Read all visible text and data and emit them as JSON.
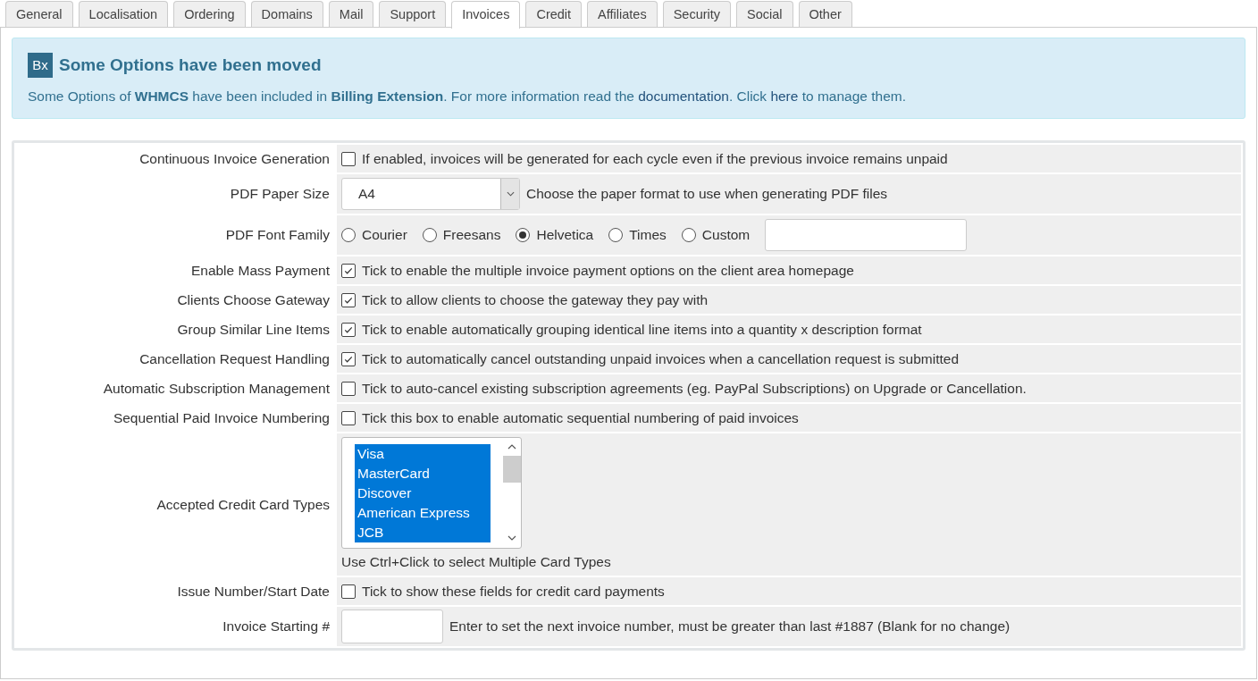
{
  "tabs": [
    {
      "label": "General",
      "selected": false
    },
    {
      "label": "Localisation",
      "selected": false
    },
    {
      "label": "Ordering",
      "selected": false
    },
    {
      "label": "Domains",
      "selected": false
    },
    {
      "label": "Mail",
      "selected": false
    },
    {
      "label": "Support",
      "selected": false
    },
    {
      "label": "Invoices",
      "selected": true
    },
    {
      "label": "Credit",
      "selected": false
    },
    {
      "label": "Affiliates",
      "selected": false
    },
    {
      "label": "Security",
      "selected": false
    },
    {
      "label": "Social",
      "selected": false
    },
    {
      "label": "Other",
      "selected": false
    }
  ],
  "alert": {
    "logo": "Bx",
    "title": "Some Options have been moved",
    "message": [
      {
        "kind": "text",
        "text": "Some Options of **WHMCS** have been included in **Billing Extension**. For more information read the "
      },
      {
        "kind": "link",
        "text": "documentation"
      },
      {
        "kind": "text",
        "text": ". Click "
      },
      {
        "kind": "link",
        "text": "here"
      },
      {
        "kind": "text",
        "text": " to manage them."
      }
    ]
  },
  "settings": [
    {
      "kind": "checkbox",
      "label": "Continuous Invoice Generation",
      "checked": false,
      "description": "If enabled, invoices will be generated for each cycle even if the previous invoice remains unpaid"
    },
    {
      "kind": "select",
      "label": "PDF Paper Size",
      "value": "A4",
      "description": "Choose the paper format to use when generating PDF files"
    },
    {
      "kind": "radio",
      "label": "PDF Font Family",
      "options": [
        {
          "label": "Courier",
          "selected": false
        },
        {
          "label": "Freesans",
          "selected": false
        },
        {
          "label": "Helvetica",
          "selected": true
        },
        {
          "label": "Times",
          "selected": false
        },
        {
          "label": "Custom",
          "selected": false
        }
      ]
    },
    {
      "kind": "checkbox",
      "label": "Enable Mass Payment",
      "checked": true,
      "description": "Tick to enable the multiple invoice payment options on the client area homepage"
    },
    {
      "kind": "checkbox",
      "label": "Clients Choose Gateway",
      "checked": true,
      "description": "Tick to allow clients to choose the gateway they pay with"
    },
    {
      "kind": "checkbox",
      "label": "Group Similar Line Items",
      "checked": true,
      "description": "Tick to enable automatically grouping identical line items into a quantity x description format"
    },
    {
      "kind": "checkbox",
      "label": "Cancellation Request Handling",
      "checked": true,
      "description": "Tick to automatically cancel outstanding unpaid invoices when a cancellation request is submitted"
    },
    {
      "kind": "checkbox",
      "label": "Automatic Subscription Management",
      "checked": false,
      "description": "Tick to auto-cancel existing subscription agreements (eg. PayPal Subscriptions) on Upgrade or Cancellation."
    },
    {
      "kind": "checkbox",
      "label": "Sequential Paid Invoice Numbering",
      "checked": false,
      "description": "Tick this box to enable automatic sequential numbering of paid invoices"
    },
    {
      "kind": "multiselect",
      "label": "Accepted Credit Card Types",
      "options": [
        {
          "label": "Visa",
          "selected": true
        },
        {
          "label": "MasterCard",
          "selected": true
        },
        {
          "label": "Discover",
          "selected": true
        },
        {
          "label": "American Express",
          "selected": true
        },
        {
          "label": "JCB",
          "selected": true
        }
      ],
      "description": "Use Ctrl+Click to select Multiple Card Types"
    },
    {
      "kind": "checkbox",
      "label": "Issue Number/Start Date",
      "checked": false,
      "description": "Tick to show these fields for credit card payments"
    },
    {
      "kind": "text",
      "label": "Invoice Starting #",
      "description": "Enter to set the next invoice number, must be greater than last #1887 (Blank for no change)"
    }
  ]
}
